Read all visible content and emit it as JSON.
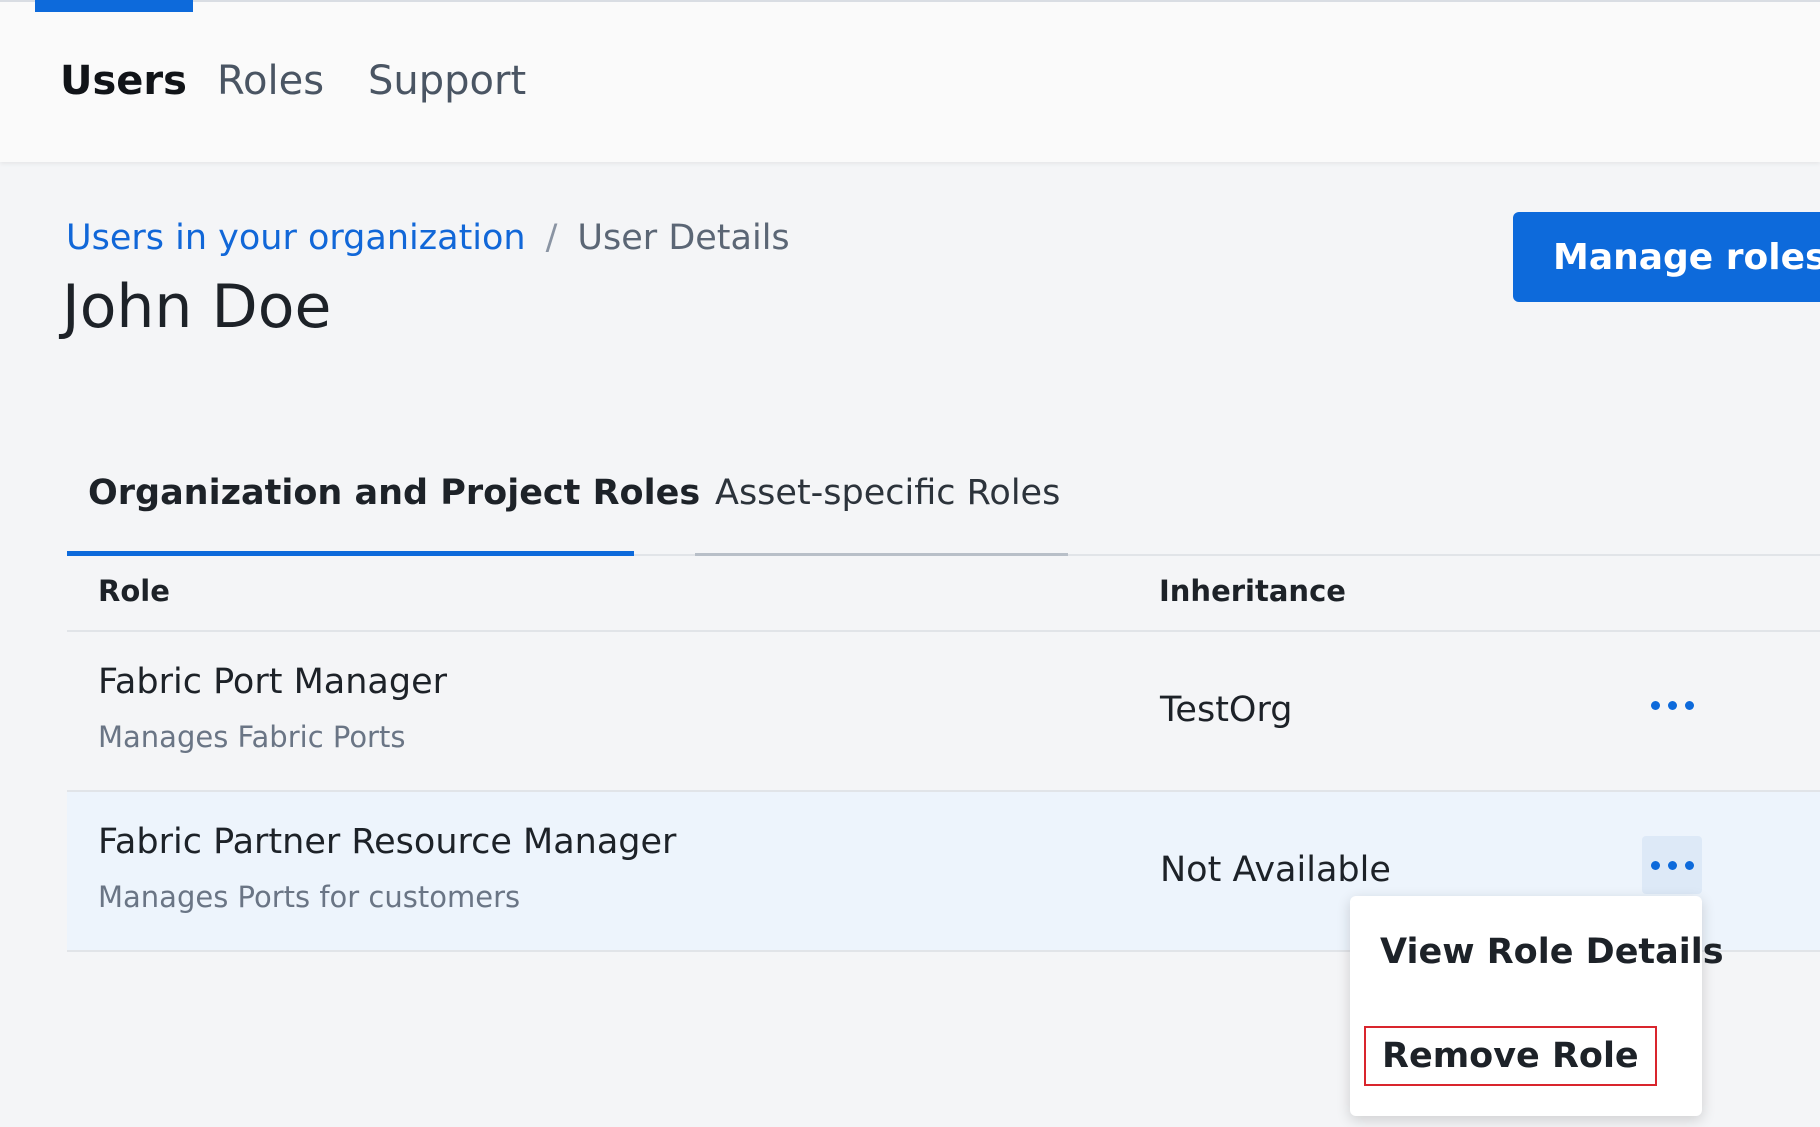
{
  "topnav": {
    "items": [
      {
        "label": "Users",
        "active": true
      },
      {
        "label": "Roles",
        "active": false
      },
      {
        "label": "Support",
        "active": false
      }
    ]
  },
  "breadcrumb": {
    "parent": "Users in your organization",
    "separator": "/",
    "current": "User Details"
  },
  "page": {
    "title": "John Doe",
    "primary_action": "Manage roles"
  },
  "tabs": [
    {
      "label": "Organization and Project Roles",
      "active": true
    },
    {
      "label": "Asset-specific Roles",
      "active": false
    }
  ],
  "table": {
    "headers": {
      "role": "Role",
      "inheritance": "Inheritance"
    },
    "rows": [
      {
        "name": "Fabric Port Manager",
        "description": "Manages Fabric Ports",
        "inheritance": "TestOrg",
        "highlighted": false
      },
      {
        "name": "Fabric Partner Resource Manager",
        "description": "Manages Ports for customers",
        "inheritance": "Not Available",
        "highlighted": true
      }
    ]
  },
  "context_menu": {
    "items": [
      "View Role Details",
      "Remove Role"
    ]
  },
  "colors": {
    "accent": "#0d6adb",
    "highlight_row": "#edf4fc",
    "focus_outline": "#d9252d"
  }
}
